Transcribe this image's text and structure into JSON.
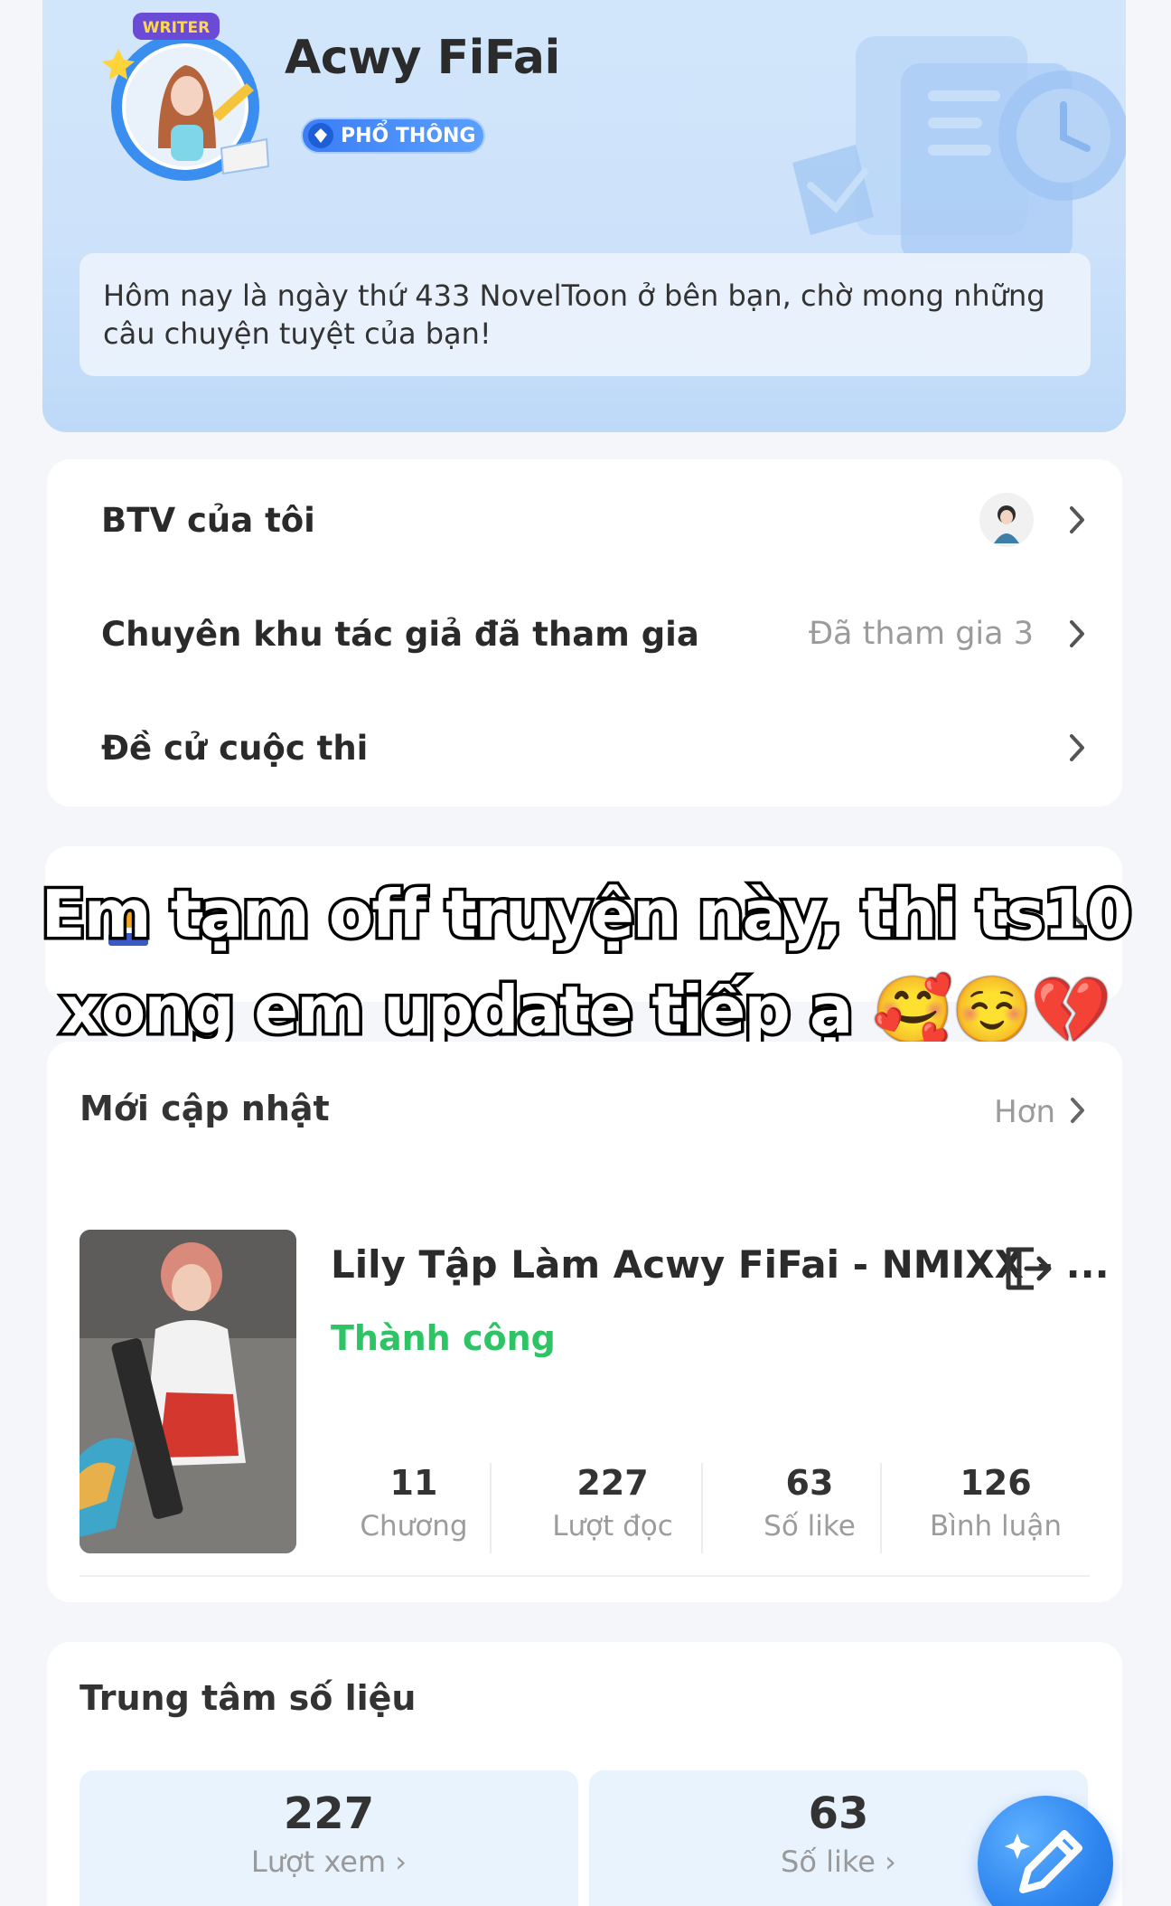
{
  "profile": {
    "avatar_badge_text": "WRITER",
    "name": "Acwy FiFai",
    "level_badge": "PHỔ THÔNG",
    "greeting": "Hôm nay là ngày thứ 433 NovelToon ở bên bạn, chờ mong những câu chuyện tuyệt của bạn!"
  },
  "menu": {
    "items": [
      {
        "label": "BTV của tôi",
        "value": ""
      },
      {
        "label": "Chuyên khu tác giả đã tham gia",
        "value": "Đã tham gia 3"
      },
      {
        "label": "Đề cử cuộc thi",
        "value": ""
      }
    ]
  },
  "overlay": {
    "line1": "Em tạm off truyện này, thi ts10",
    "line2": "xong em update tiếp ạ 🥰☺️💔"
  },
  "updates": {
    "title": "Mới cập nhật",
    "more_label": "Hơn",
    "story": {
      "title": "Lily Tập Làm Acwy FiFai - NMIXX - ...",
      "status": "Thành công",
      "stats": [
        {
          "value": "11",
          "label": "Chương"
        },
        {
          "value": "227",
          "label": "Lượt đọc"
        },
        {
          "value": "63",
          "label": "Số like"
        },
        {
          "value": "126",
          "label": "Bình luận"
        }
      ]
    }
  },
  "data_center": {
    "title": "Trung tâm số liệu",
    "boxes": [
      {
        "value": "227",
        "label": "Lượt xem ›"
      },
      {
        "value": "63",
        "label": "Số like ›"
      }
    ]
  },
  "colors": {
    "header_bg": "#cde2fa",
    "level_badge": "#3b7df6",
    "status_success": "#2ec466",
    "fab": "#2f86ef"
  },
  "icons": {
    "chevron": "chevron-right-icon",
    "export": "export-icon",
    "fab": "edit-pencil-icon",
    "trophy": "trophy-icon"
  }
}
